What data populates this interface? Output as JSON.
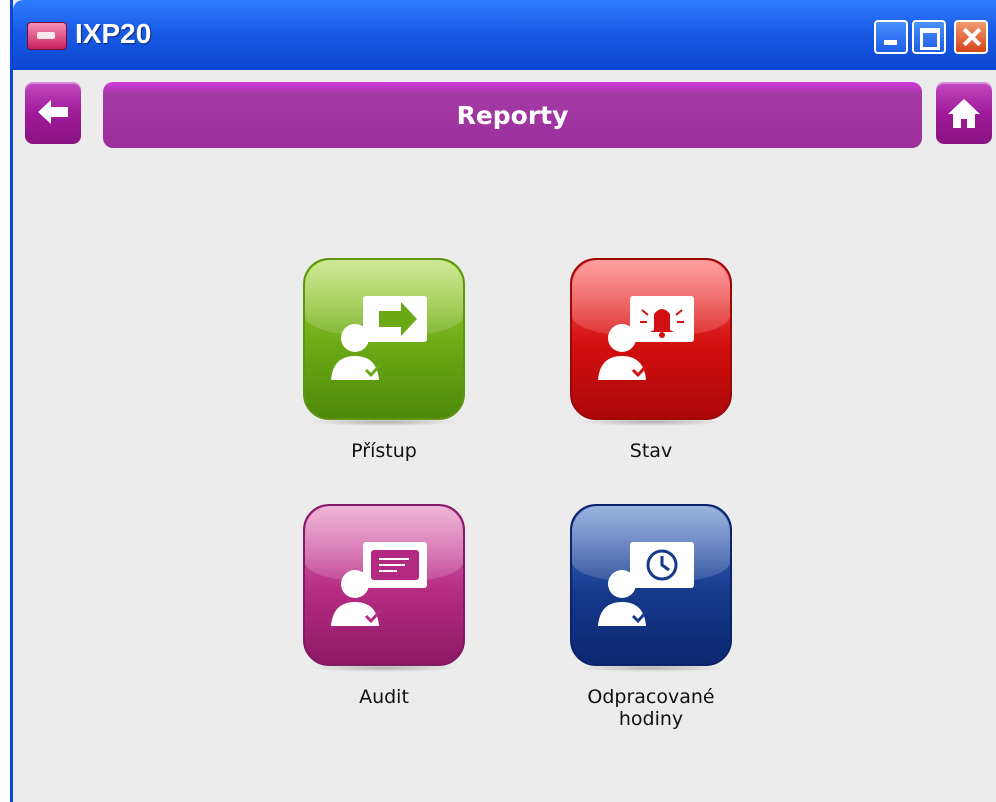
{
  "window": {
    "title": "IXP20"
  },
  "header": {
    "title": "Reporty",
    "back_icon": "arrow-left-icon",
    "home_icon": "home-icon"
  },
  "tiles": [
    {
      "label": "Přístup",
      "icon": "access-report-icon",
      "color": "#6aa915"
    },
    {
      "label": "Stav",
      "icon": "status-report-icon",
      "color": "#d10f0f"
    },
    {
      "label": "Audit",
      "icon": "audit-report-icon",
      "color": "#b42a82"
    },
    {
      "label": "Odpracované hodiny",
      "icon": "worked-hours-report-icon",
      "color": "#16398c"
    }
  ]
}
